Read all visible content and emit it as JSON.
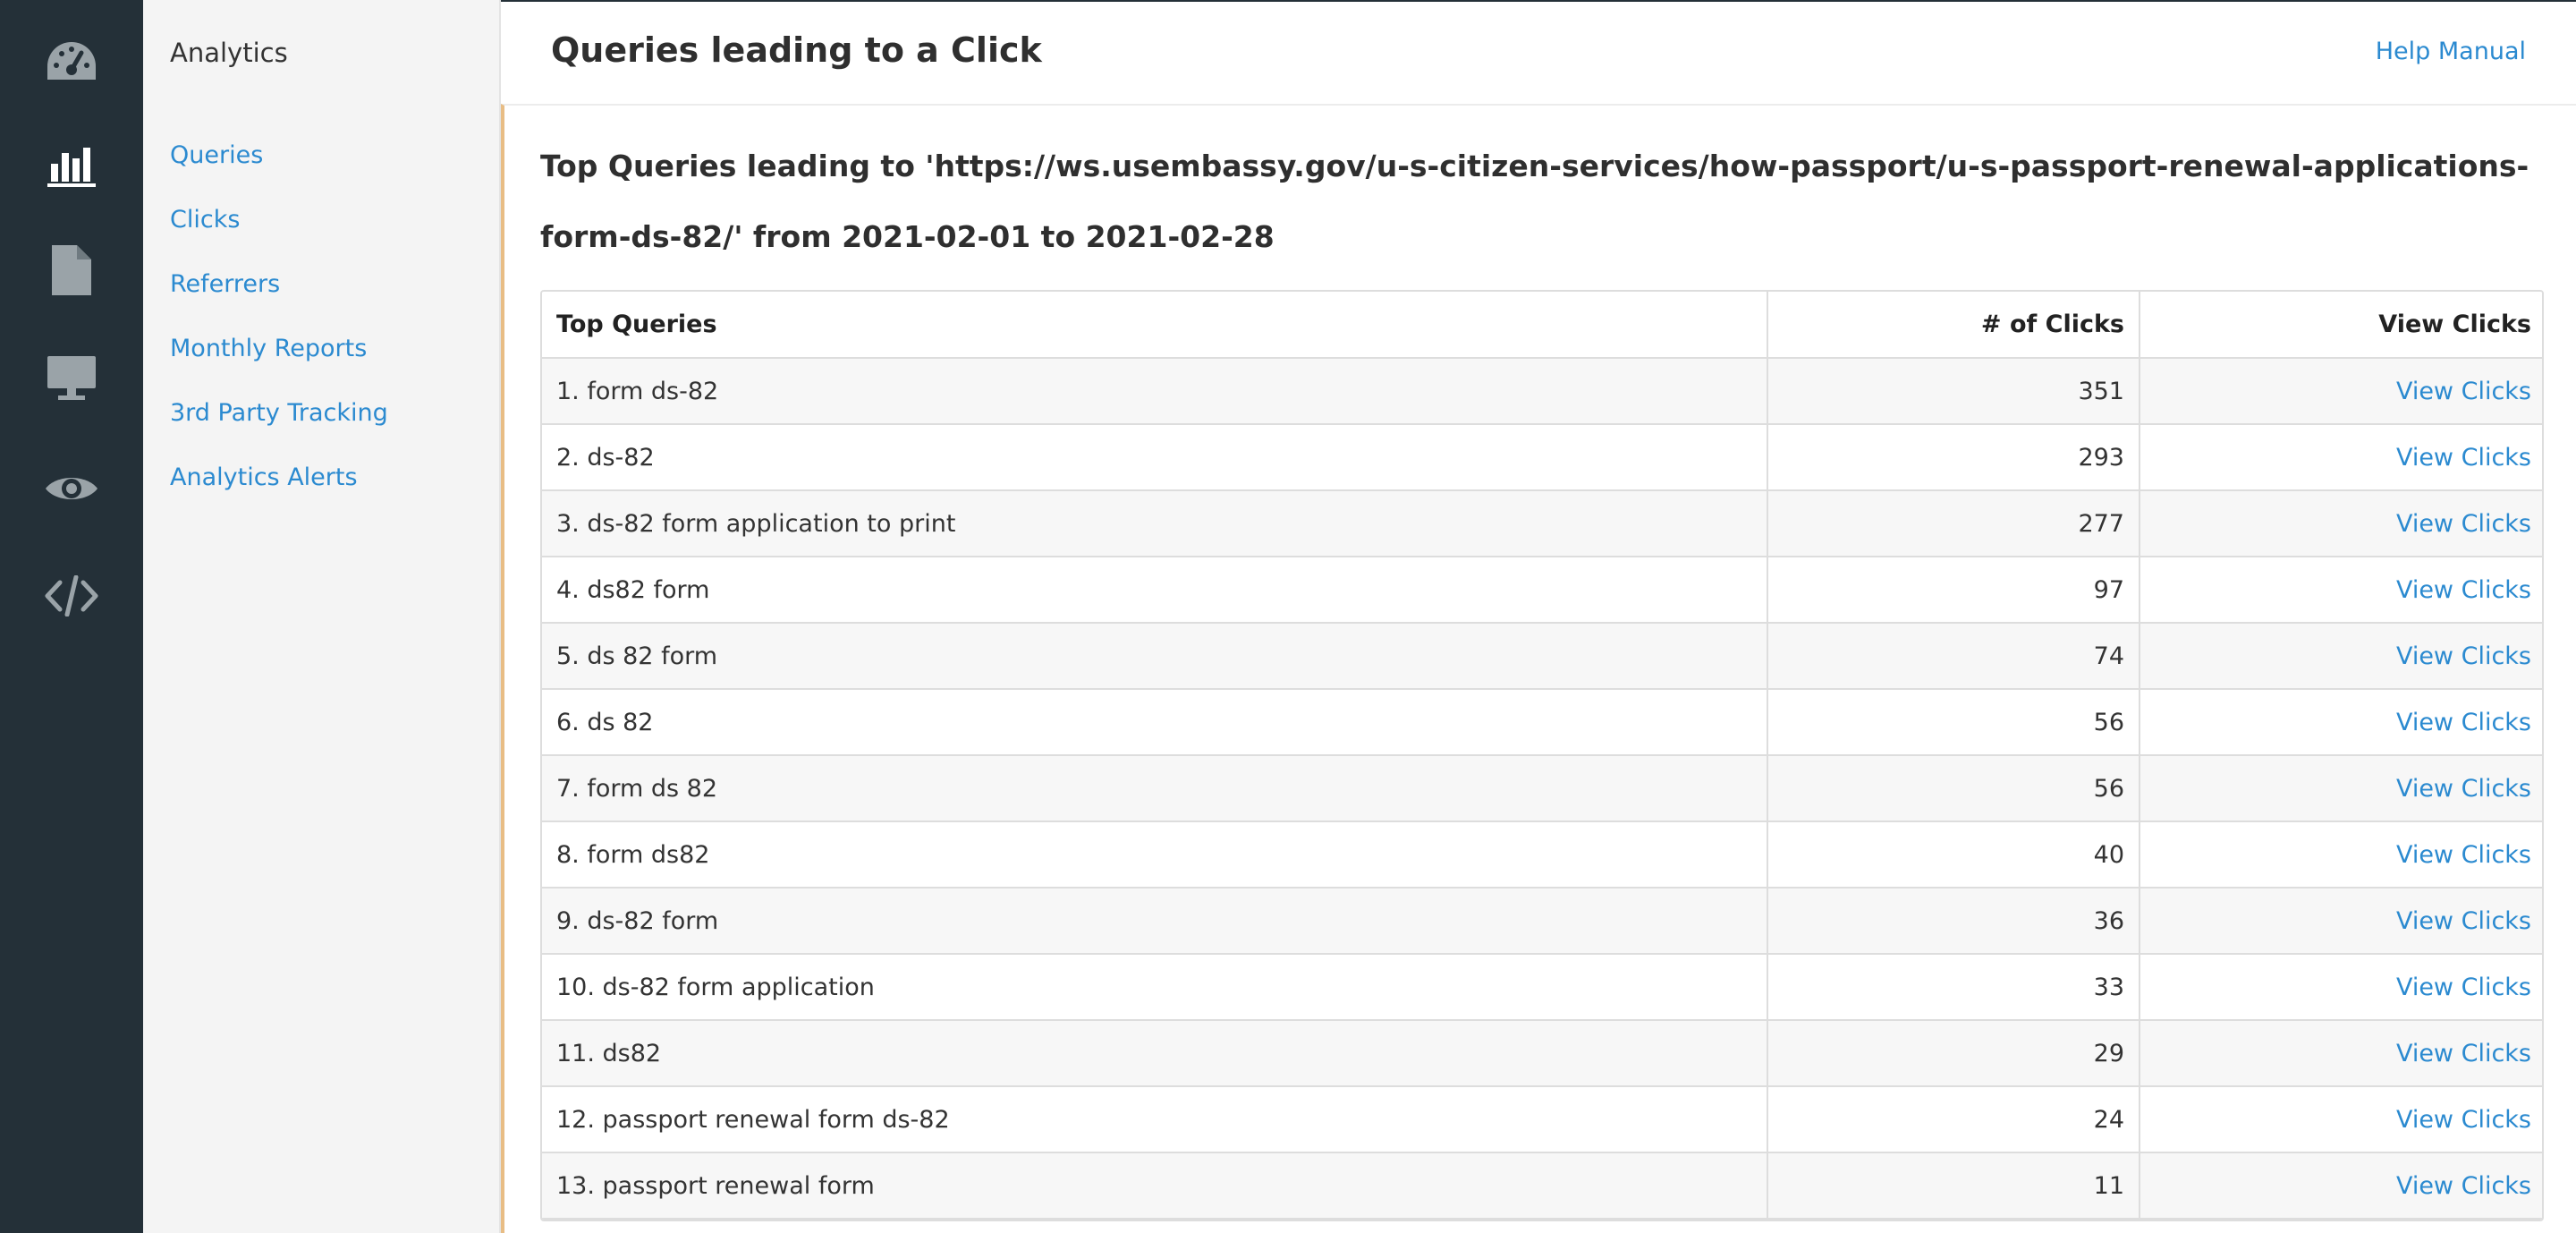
{
  "rail": {
    "icons": [
      "dashboard-icon",
      "analytics-icon",
      "document-icon",
      "monitor-icon",
      "eye-icon",
      "code-icon"
    ],
    "active": "analytics-icon",
    "color": "#9aa3a8",
    "active_color": "#ffffff"
  },
  "subnav": {
    "title": "Analytics",
    "items": [
      {
        "label": "Queries"
      },
      {
        "label": "Clicks"
      },
      {
        "label": "Referrers"
      },
      {
        "label": "Monthly Reports"
      },
      {
        "label": "3rd Party Tracking"
      },
      {
        "label": "Analytics Alerts"
      }
    ]
  },
  "header": {
    "title": "Queries leading to a Click",
    "help_link": "Help Manual"
  },
  "report": {
    "heading": "Top Queries leading to 'https://ws.usembassy.gov/u-s-citizen-services/how-passport/u-s-passport-renewal-applications-form-ds-82/' from 2021-02-01 to 2021-02-28",
    "columns": [
      "Top Queries",
      "# of Clicks",
      "View Clicks"
    ],
    "rows": [
      {
        "query": "1. form ds-82",
        "clicks": "351",
        "link": "View Clicks"
      },
      {
        "query": "2. ds-82",
        "clicks": "293",
        "link": "View Clicks"
      },
      {
        "query": "3. ds-82 form application to print",
        "clicks": "277",
        "link": "View Clicks"
      },
      {
        "query": "4. ds82 form",
        "clicks": "97",
        "link": "View Clicks"
      },
      {
        "query": "5. ds 82 form",
        "clicks": "74",
        "link": "View Clicks"
      },
      {
        "query": "6. ds 82",
        "clicks": "56",
        "link": "View Clicks"
      },
      {
        "query": "7. form ds 82",
        "clicks": "56",
        "link": "View Clicks"
      },
      {
        "query": "8. form ds82",
        "clicks": "40",
        "link": "View Clicks"
      },
      {
        "query": "9. ds-82 form",
        "clicks": "36",
        "link": "View Clicks"
      },
      {
        "query": "10. ds-82 form application",
        "clicks": "33",
        "link": "View Clicks"
      },
      {
        "query": "11. ds82",
        "clicks": "29",
        "link": "View Clicks"
      },
      {
        "query": "12. passport renewal form ds-82",
        "clicks": "24",
        "link": "View Clicks"
      },
      {
        "query": "13. passport renewal form",
        "clicks": "11",
        "link": "View Clicks"
      }
    ]
  }
}
